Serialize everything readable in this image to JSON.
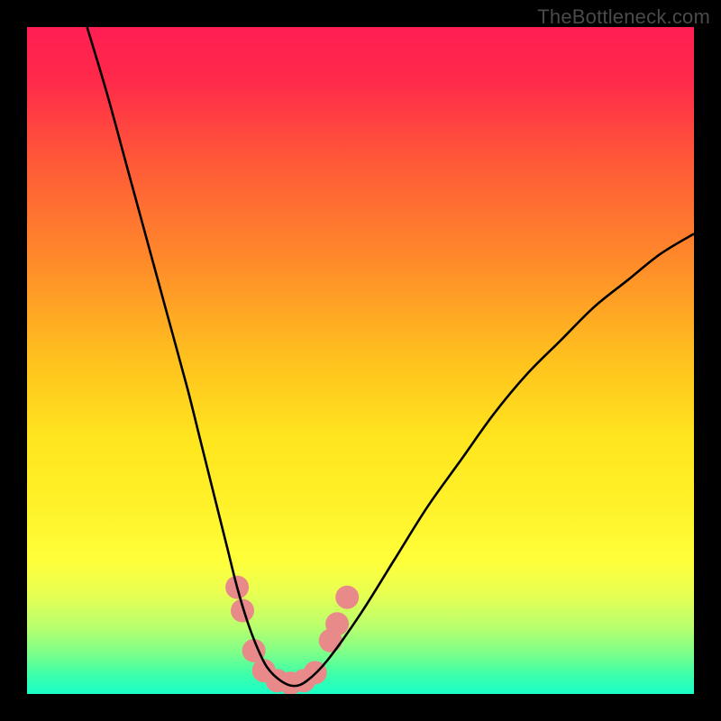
{
  "watermark": "TheBottleneck.com",
  "chart_data": {
    "type": "line",
    "title": "",
    "xlabel": "",
    "ylabel": "",
    "xlim": [
      0,
      100
    ],
    "ylim": [
      0,
      100
    ],
    "background_gradient": {
      "stops": [
        {
          "offset": 0.0,
          "color": "#ff1e52"
        },
        {
          "offset": 0.08,
          "color": "#ff2a4a"
        },
        {
          "offset": 0.2,
          "color": "#ff5838"
        },
        {
          "offset": 0.35,
          "color": "#ff8a2a"
        },
        {
          "offset": 0.5,
          "color": "#ffc21e"
        },
        {
          "offset": 0.62,
          "color": "#ffe61e"
        },
        {
          "offset": 0.72,
          "color": "#fff22a"
        },
        {
          "offset": 0.8,
          "color": "#ffff3a"
        },
        {
          "offset": 0.85,
          "color": "#e8ff52"
        },
        {
          "offset": 0.9,
          "color": "#b8ff6e"
        },
        {
          "offset": 0.94,
          "color": "#7aff8a"
        },
        {
          "offset": 0.97,
          "color": "#3effa8"
        },
        {
          "offset": 1.0,
          "color": "#1affc8"
        }
      ]
    },
    "series": [
      {
        "name": "bottleneck-curve",
        "x": [
          9,
          12,
          15,
          18,
          21,
          24,
          26,
          28,
          30,
          31.5,
          33,
          34.5,
          36,
          38,
          40,
          42,
          45,
          50,
          55,
          60,
          65,
          70,
          75,
          80,
          85,
          90,
          95,
          100
        ],
        "y": [
          100,
          90,
          79,
          68,
          57,
          46,
          38,
          30,
          22,
          16,
          11,
          7,
          4,
          2,
          1.2,
          2,
          5,
          12,
          20,
          28,
          35,
          42,
          48,
          53,
          58,
          62,
          66,
          69
        ]
      }
    ],
    "markers": {
      "name": "highlight-points",
      "color": "#e88a8a",
      "radius": 13,
      "points": [
        {
          "x": 31.5,
          "y": 16
        },
        {
          "x": 32.3,
          "y": 12.5
        },
        {
          "x": 34.0,
          "y": 6.5
        },
        {
          "x": 35.5,
          "y": 3.5
        },
        {
          "x": 37.5,
          "y": 2.0
        },
        {
          "x": 39.5,
          "y": 1.6
        },
        {
          "x": 41.5,
          "y": 2.0
        },
        {
          "x": 43.2,
          "y": 3.2
        },
        {
          "x": 45.5,
          "y": 8.0
        },
        {
          "x": 46.5,
          "y": 10.5
        },
        {
          "x": 48.0,
          "y": 14.5
        }
      ]
    },
    "annotations": []
  }
}
